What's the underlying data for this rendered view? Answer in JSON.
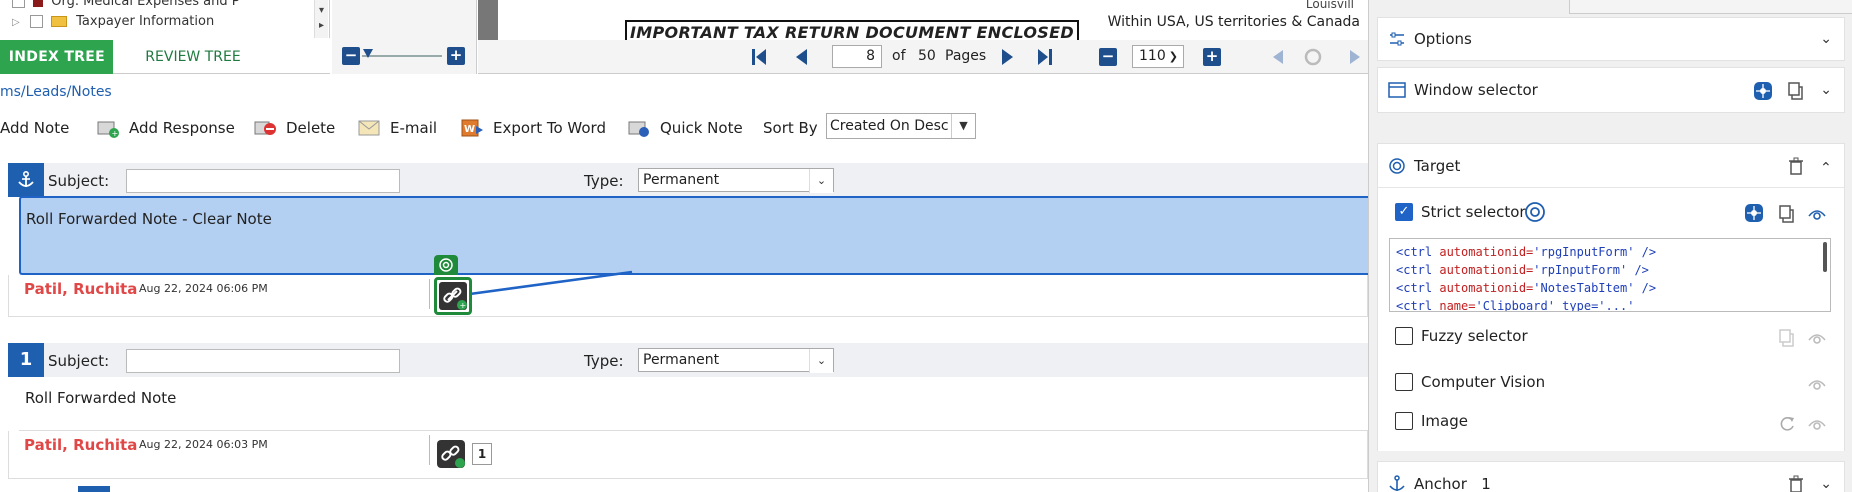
{
  "tree": {
    "row_partial_top": "Org. Medical Expenses and P",
    "row_visible": "Taxpayer Information",
    "tab_index_label": "INDEX TREE",
    "tab_review_label": "REVIEW TREE"
  },
  "document": {
    "heading": "IMPORTANT TAX RETURN DOCUMENT ENCLOSED",
    "side_text": "Within USA, US territories & Canada",
    "city_text": "Louisvill"
  },
  "pager": {
    "current_page": "8",
    "of_label": "of",
    "total_pages": "50",
    "pages_label": "Pages",
    "zoom": "110"
  },
  "breadcrumb": "ms/Leads/Notes",
  "toolbar": {
    "add_note": "Add Note",
    "add_response": "Add Response",
    "delete": "Delete",
    "email": "E-mail",
    "export_word": "Export To Word",
    "quick_note": "Quick Note",
    "sort_by": "Sort By",
    "sort_value": "Created On Desc"
  },
  "notes": [
    {
      "badge": "",
      "subject_label": "Subject:",
      "type_label": "Type:",
      "type_value": "Permanent",
      "text": "Roll Forwarded Note - Clear Note",
      "author": "Patil, Ruchita",
      "date": "Aug 22, 2024 06:06 PM"
    },
    {
      "badge": "1",
      "subject_label": "Subject:",
      "type_label": "Type:",
      "type_value": "Permanent",
      "text": "Roll Forwarded Note",
      "author": "Patil, Ruchita",
      "date": "Aug 22, 2024 06:03 PM",
      "link_count": "1"
    }
  ],
  "panel": {
    "options": "Options",
    "window_selector": "Window selector",
    "target": "Target",
    "strict_selector": "Strict selector",
    "code_lines": [
      {
        "tag": "<ctrl",
        "attr": "automationid=",
        "val": "'rpgInputForm'",
        "end": "/>"
      },
      {
        "tag": "<ctrl",
        "attr": "automationid=",
        "val": "'rpInputForm'",
        "end": "/>"
      },
      {
        "tag": "<ctrl",
        "attr": "automationid=",
        "val": "'NotesTabItem'",
        "end": "/>"
      },
      {
        "tag": "<ctrl",
        "attr": "name=",
        "val": "'Clipboard' type='...'",
        "end": ""
      }
    ],
    "fuzzy_selector": "Fuzzy selector",
    "computer_vision": "Computer Vision",
    "image": "Image",
    "anchor": "Anchor",
    "anchor_count": "1"
  },
  "colors": {
    "accent_blue": "#1f5fb0",
    "tab_green": "#2ea44f",
    "selected_note_bg": "#b3cff2",
    "author_red": "#e04848"
  }
}
